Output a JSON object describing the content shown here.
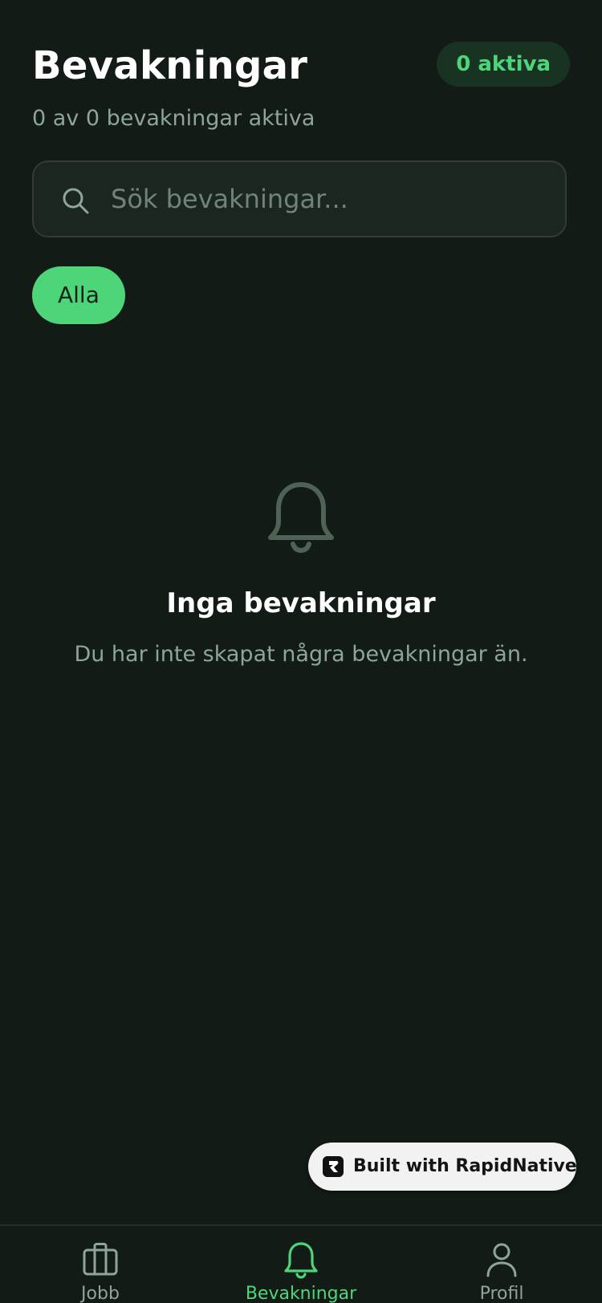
{
  "header": {
    "title": "Bevakningar",
    "active_badge": "0 aktiva",
    "subtitle": "0 av 0 bevakningar aktiva"
  },
  "search": {
    "placeholder": "Sök bevakningar...",
    "value": "",
    "icon": "search-icon"
  },
  "filters": {
    "chips": [
      {
        "label": "Alla",
        "selected": true
      }
    ]
  },
  "empty_state": {
    "icon": "bell-icon",
    "title": "Inga bevakningar",
    "message": "Du har inte skapat några bevakningar än."
  },
  "built_badge": {
    "label": "Built with RapidNative",
    "icon": "rapidnative-logo-icon"
  },
  "bottom_nav": {
    "items": [
      {
        "label": "Jobb",
        "icon": "briefcase-icon",
        "active": false
      },
      {
        "label": "Bevakningar",
        "icon": "bell-icon",
        "active": true
      },
      {
        "label": "Profil",
        "icon": "user-icon",
        "active": false
      }
    ]
  },
  "colors": {
    "background": "#121b16",
    "accent": "#4fd579",
    "muted_text": "#8da696",
    "badge_bg": "#193323",
    "search_bg": "#1c2621",
    "search_border": "#2f3d34"
  }
}
